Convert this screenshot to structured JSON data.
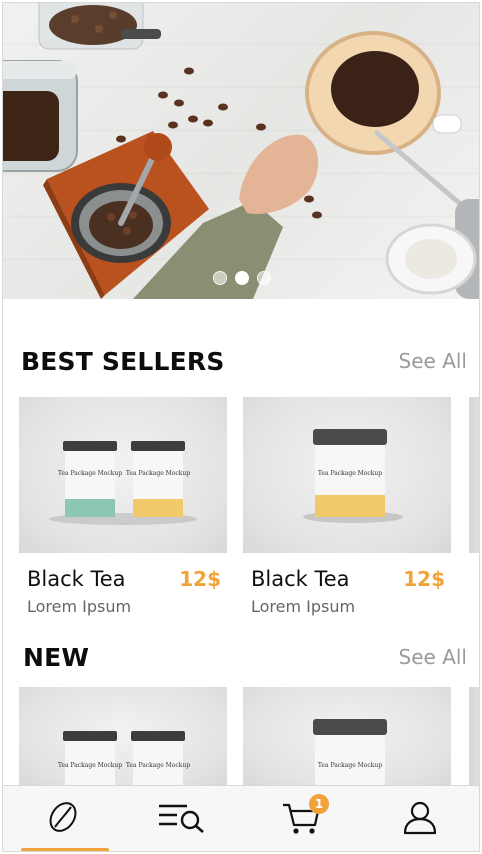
{
  "hero": {
    "slide_count": 3,
    "active_slide": 1
  },
  "best_sellers": {
    "title": "BEST SELLERS",
    "see_all": "See All",
    "items": [
      {
        "name": "Black Tea",
        "subtitle": "Lorem Ipsum",
        "price": "12$",
        "image_label": "Tea Package Mockup"
      },
      {
        "name": "Black Tea",
        "subtitle": "Lorem Ipsum",
        "price": "12$",
        "image_label": "Tea Package Mockup"
      }
    ]
  },
  "new": {
    "title": "NEW",
    "see_all": "See All",
    "items": [
      {
        "image_label": "Tea Package Mockup"
      },
      {
        "image_label": "Tea Package Mockup"
      }
    ]
  },
  "tabbar": {
    "tabs": [
      {
        "icon": "coffee-bean-icon",
        "active": true
      },
      {
        "icon": "search-list-icon",
        "active": false
      },
      {
        "icon": "cart-icon",
        "active": false,
        "badge": "1"
      },
      {
        "icon": "user-icon",
        "active": false
      }
    ]
  },
  "colors": {
    "accent": "#f2a23a",
    "muted_text": "#9a9a9a"
  }
}
